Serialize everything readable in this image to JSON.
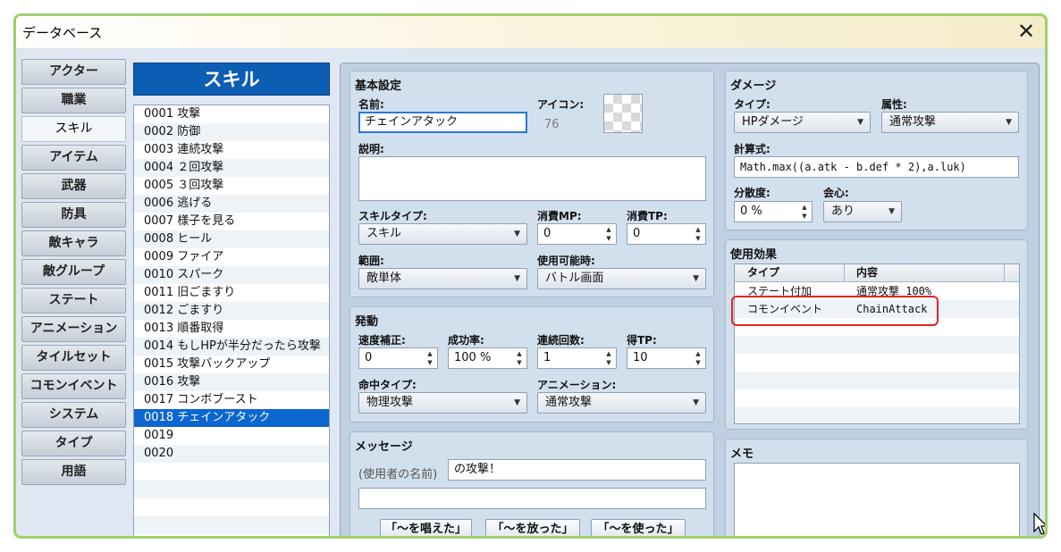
{
  "window": {
    "title": "データベース",
    "close_icon": "close-icon"
  },
  "tabs": [
    "アクター",
    "職業",
    "スキル",
    "アイテム",
    "武器",
    "防具",
    "敵キャラ",
    "敵グループ",
    "ステート",
    "アニメーション",
    "タイルセット",
    "コモンイベント",
    "システム",
    "タイプ",
    "用語"
  ],
  "selected_tab": "スキル",
  "list": {
    "title": "スキル",
    "items": [
      "0001 攻撃",
      "0002 防御",
      "0003 連続攻撃",
      "0004 ２回攻撃",
      "0005 ３回攻撃",
      "0006 逃げる",
      "0007 様子を見る",
      "0008 ヒール",
      "0009 ファイア",
      "0010 スパーク",
      "0011 旧ごますり",
      "0012 ごますり",
      "0013 順番取得",
      "0014 もしHPが半分だったら攻撃",
      "0015 攻撃バックアップ",
      "0016 攻撃",
      "0017 コンボブースト",
      "0018 チェインアタック",
      "0019",
      "0020",
      "",
      "",
      "",
      "",
      ""
    ],
    "selected_index": 17
  },
  "basic": {
    "header": "基本設定",
    "name_label": "名前:",
    "name_value": "チェインアタック",
    "icon_label": "アイコン:",
    "icon_index": "76",
    "desc_label": "説明:",
    "desc_value": "",
    "skilltype_label": "スキルタイプ:",
    "skilltype_value": "スキル",
    "mp_label": "消費MP:",
    "mp_value": "0",
    "tp_label": "消費TP:",
    "tp_value": "0",
    "scope_label": "範囲:",
    "scope_value": "敵単体",
    "occasion_label": "使用可能時:",
    "occasion_value": "バトル画面"
  },
  "invocation": {
    "header": "発動",
    "speed_label": "速度補正:",
    "speed_value": "0",
    "success_label": "成功率:",
    "success_value": "100 %",
    "repeat_label": "連続回数:",
    "repeat_value": "1",
    "tpgain_label": "得TP:",
    "tpgain_value": "10",
    "hittype_label": "命中タイプ:",
    "hittype_value": "物理攻撃",
    "anim_label": "アニメーション:",
    "anim_value": "通常攻撃"
  },
  "message": {
    "header": "メッセージ",
    "user_name_label": "(使用者の名前)",
    "line1": "の攻撃！",
    "line2": "",
    "buttons": [
      "「～を唱えた」",
      "「～を放った」",
      "「～を使った」"
    ]
  },
  "damage": {
    "header": "ダメージ",
    "type_label": "タイプ:",
    "type_value": "HPダメージ",
    "element_label": "属性:",
    "element_value": "通常攻撃",
    "formula_label": "計算式:",
    "formula_value": "Math.max((a.atk - b.def * 2),a.luk)",
    "variance_label": "分散度:",
    "variance_value": "0 %",
    "critical_label": "会心:",
    "critical_value": "あり"
  },
  "effects": {
    "header": "使用効果",
    "col_type": "タイプ",
    "col_content": "内容",
    "rows": [
      {
        "type": "ステート付加",
        "content": "通常攻撃 100%"
      },
      {
        "type": "コモンイベント",
        "content": "ChainAttack"
      },
      {
        "type": "",
        "content": ""
      },
      {
        "type": "",
        "content": ""
      },
      {
        "type": "",
        "content": ""
      },
      {
        "type": "",
        "content": ""
      },
      {
        "type": "",
        "content": ""
      },
      {
        "type": "",
        "content": ""
      }
    ],
    "highlight_color": "#e32424"
  },
  "note": {
    "header": "メモ",
    "value": ""
  },
  "colors": {
    "accent": "#0c5db4",
    "selection": "#0c66cf",
    "frame": "#9fd06a"
  }
}
